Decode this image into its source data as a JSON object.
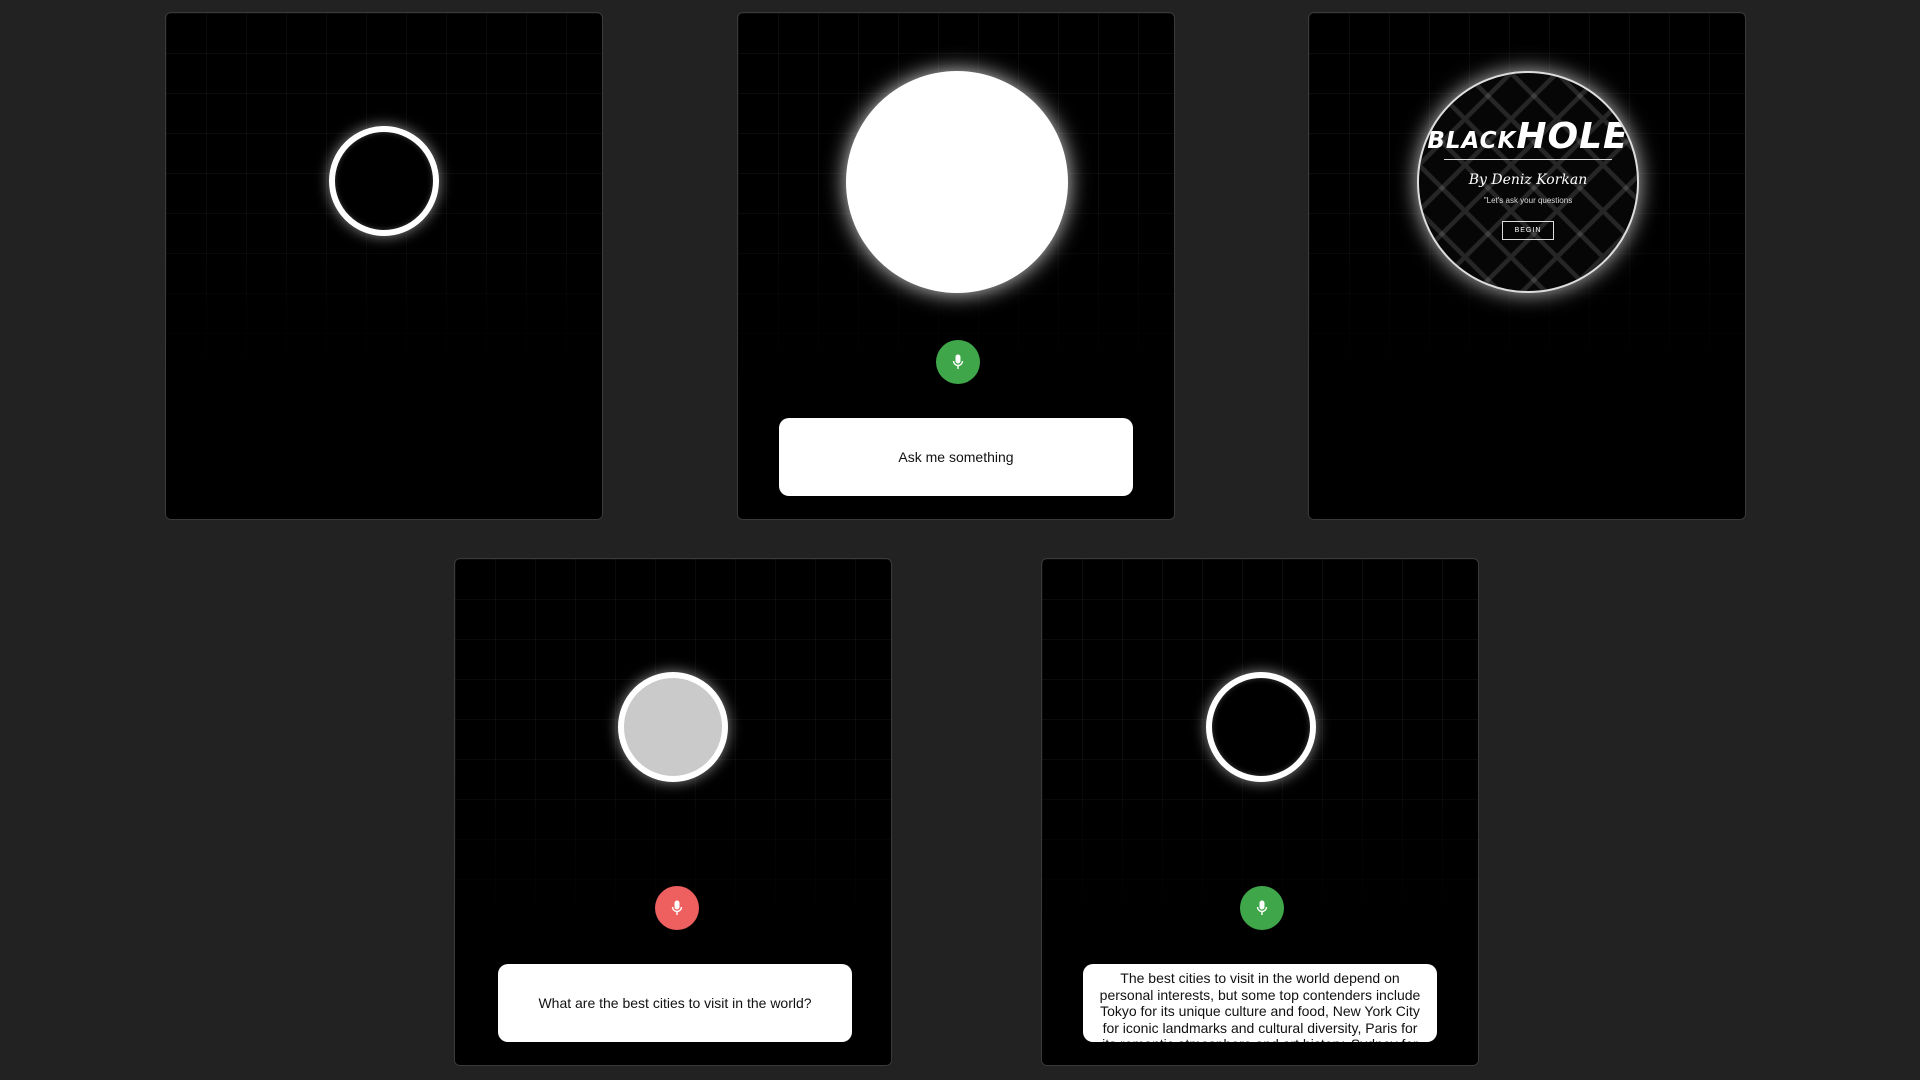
{
  "panels": {
    "p1": {
      "orb_state": "idle-dark-ring"
    },
    "p2": {
      "orb_state": "white-glow",
      "mic_color": "#3fa74a",
      "prompt_text": "Ask me something"
    },
    "p3": {
      "orb_state": "logo",
      "logo": {
        "title_small": "BLACK",
        "title_big": "HOLE",
        "author": "By Deniz Korkan",
        "tagline": "\"Let's ask your questions",
        "begin_label": "BEGIN"
      }
    },
    "p4": {
      "orb_state": "grey-listening",
      "mic_color": "#ee5f5f",
      "question_text": "What are the best cities to visit in the world?"
    },
    "p5": {
      "orb_state": "dark-ring",
      "mic_color": "#3fa74a",
      "answer_text": "The best cities to visit in the world depend on personal interests, but some top contenders include Tokyo for its unique culture and food, New York City for iconic landmarks and cultural diversity, Paris for its romantic atmosphere and art history, Sydney for"
    }
  },
  "icons": {
    "mic": "microphone-icon"
  },
  "colors": {
    "page_bg": "#222222",
    "panel_bg": "#000000",
    "mic_green": "#3fa74a",
    "mic_red": "#ee5f5f"
  }
}
